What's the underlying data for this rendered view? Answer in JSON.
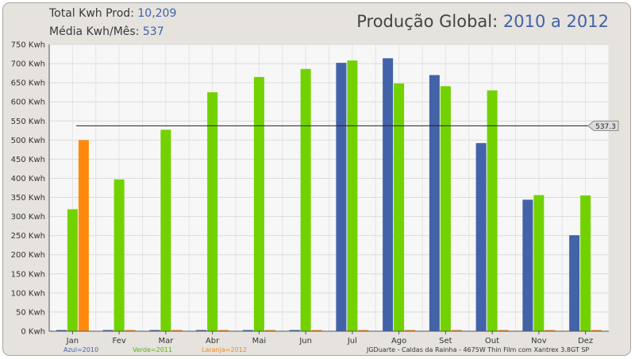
{
  "header": {
    "total_label": "Total Kwh Prod:",
    "total_value": "10,209",
    "avg_label": "Média Kwh/Mês:",
    "avg_value": "537"
  },
  "chart_data": {
    "type": "bar",
    "title_prefix": "Produção Global:",
    "title_range": "2010 a 2012",
    "categories": [
      "Jan",
      "Fev",
      "Mar",
      "Abr",
      "Mai",
      "Jun",
      "Jul",
      "Ago",
      "Set",
      "Out",
      "Nov",
      "Dez"
    ],
    "series": [
      {
        "name": "Azul=2010",
        "color": "#4263a8",
        "values": [
          0,
          0,
          0,
          0,
          0,
          0,
          702,
          714,
          670,
          492,
          344,
          251
        ]
      },
      {
        "name": "Verde=2011",
        "color": "#72d200",
        "values": [
          319,
          397,
          527,
          625,
          665,
          686,
          708,
          648,
          641,
          630,
          356,
          355
        ]
      },
      {
        "name": "Laranja=2012",
        "color": "#ff8a0c",
        "values": [
          500,
          0,
          0,
          0,
          0,
          0,
          0,
          0,
          0,
          0,
          0,
          0
        ]
      }
    ],
    "ylim": [
      0,
      750
    ],
    "y_ticks": [
      "0 Kwh",
      "50 Kwh",
      "100 Kwh",
      "150 Kwh",
      "200 Kwh",
      "250 Kwh",
      "300 Kwh",
      "350 Kwh",
      "400 Kwh",
      "450 Kwh",
      "500 Kwh",
      "550 Kwh",
      "600 Kwh",
      "650 Kwh",
      "700 Kwh",
      "750 Kwh"
    ],
    "average_line": {
      "value": 537.3,
      "label": "537.3"
    },
    "grid": true,
    "legend_position": "bottom-left",
    "footnote": "JGDuarte  -  Caldas da Rainha  -  4675W Thin Film com Xantrex 3.8GT SP"
  }
}
